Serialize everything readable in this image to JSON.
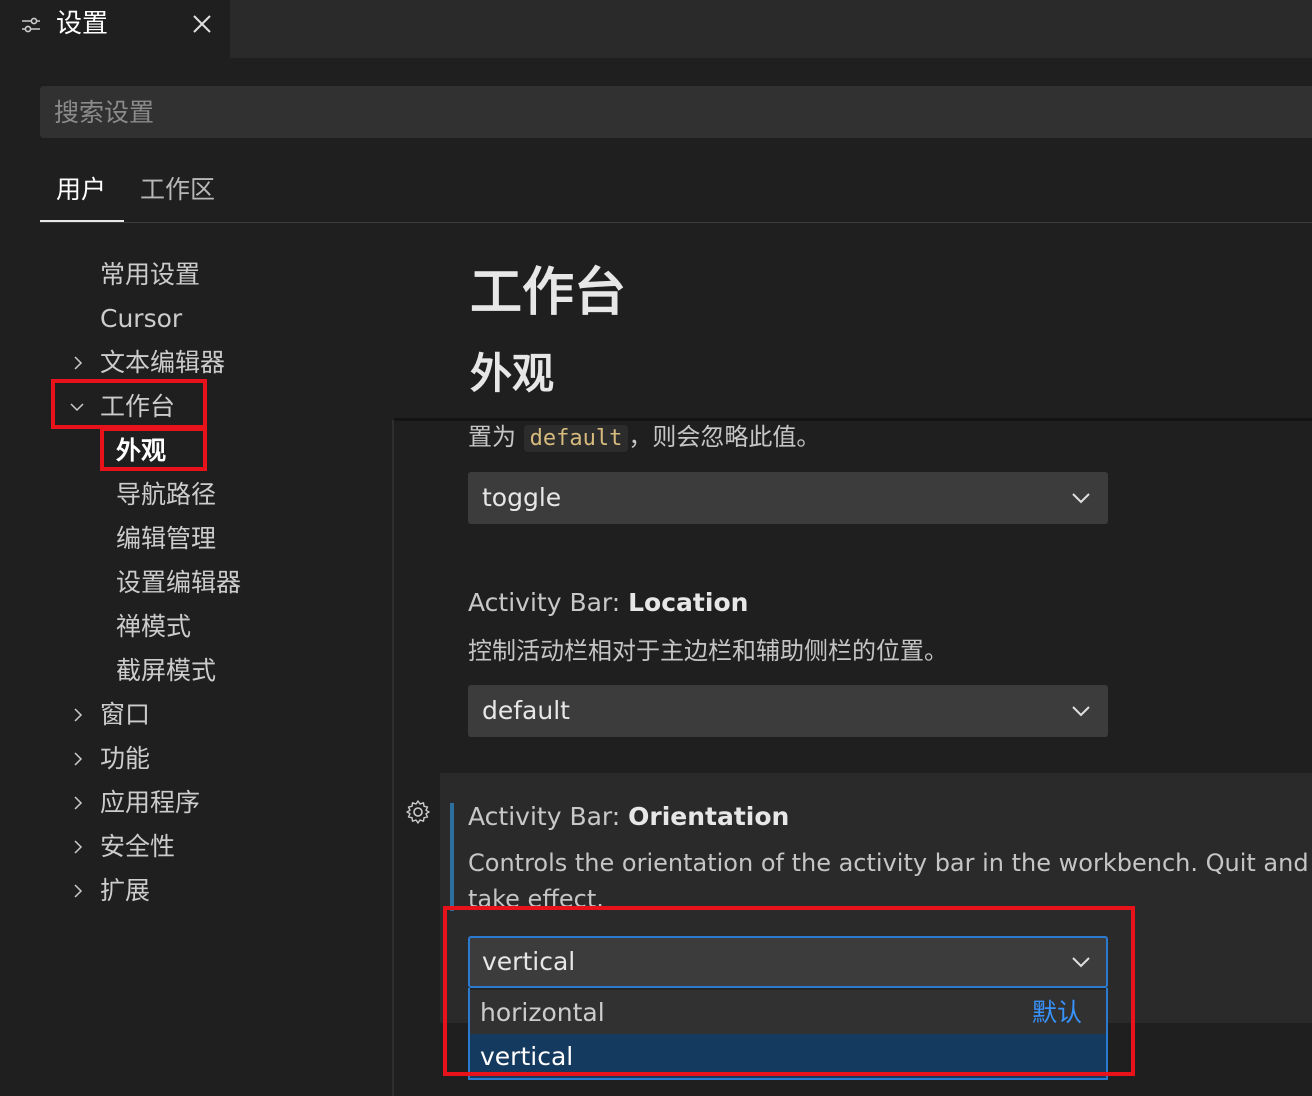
{
  "tab": {
    "title": "设置",
    "icon": "settings-sliders-icon"
  },
  "search": {
    "placeholder": "搜索设置"
  },
  "scope_tabs": {
    "user": "用户",
    "workspace": "工作区"
  },
  "toc": [
    {
      "label": "常用设置"
    },
    {
      "label": "Cursor"
    },
    {
      "label": "文本编辑器"
    },
    {
      "label": "工作台"
    },
    {
      "label": "外观"
    },
    {
      "label": "导航路径"
    },
    {
      "label": "编辑管理"
    },
    {
      "label": "设置编辑器"
    },
    {
      "label": "禅模式"
    },
    {
      "label": "截屏模式"
    },
    {
      "label": "窗口"
    },
    {
      "label": "功能"
    },
    {
      "label": "应用程序"
    },
    {
      "label": "安全性"
    },
    {
      "label": "扩展"
    }
  ],
  "content": {
    "section_title": "工作台",
    "subsection_title": "外观",
    "prev_setting": {
      "desc_prefix": "置为",
      "desc_code": "default",
      "desc_suffix": "，则会忽略此值。",
      "value": "toggle"
    },
    "location_setting": {
      "category": "Activity Bar: ",
      "name": "Location",
      "description": "控制活动栏相对于主边栏和辅助侧栏的位置。",
      "value": "default"
    },
    "orientation_setting": {
      "category": "Activity Bar: ",
      "name": "Orientation",
      "description_line1": "Controls the orientation of the activity bar in the workbench. Quit and",
      "description_line2": "take effect.",
      "value": "vertical",
      "options": [
        {
          "label": "horizontal",
          "tag": "默认"
        },
        {
          "label": "vertical"
        }
      ]
    }
  },
  "colors": {
    "highlight": "#e8121b",
    "accent": "#2a7ad0",
    "default_tag": "#3794ff"
  }
}
